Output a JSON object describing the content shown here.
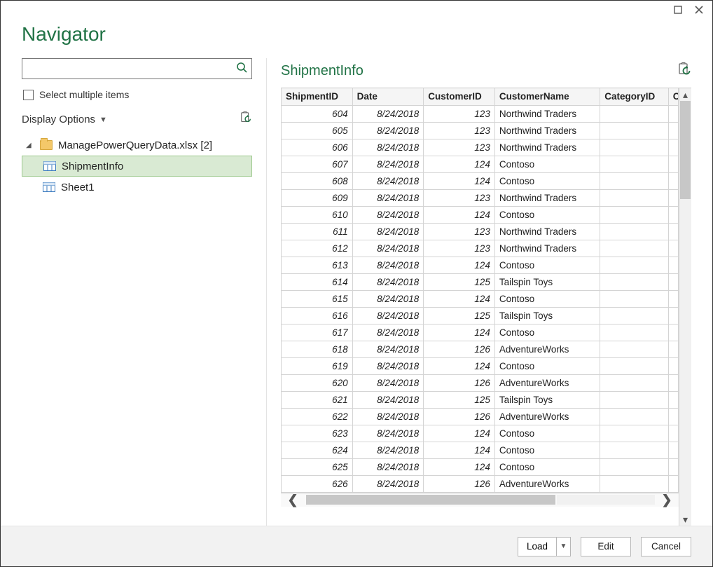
{
  "dialog_title": "Navigator",
  "left": {
    "search_placeholder": "",
    "select_multiple_label": "Select multiple items",
    "display_options_label": "Display Options",
    "tree": {
      "root_label": "ManagePowerQueryData.xlsx [2]",
      "items": [
        {
          "label": "ShipmentInfo",
          "selected": true
        },
        {
          "label": "Sheet1",
          "selected": false
        }
      ]
    }
  },
  "right": {
    "title": "ShipmentInfo",
    "columns": [
      "ShipmentID",
      "Date",
      "CustomerID",
      "CustomerName",
      "CategoryID",
      "C"
    ],
    "rows": [
      {
        "sid": "604",
        "date": "8/24/2018",
        "cid": "123",
        "cname": "Northwind Traders",
        "cat": ""
      },
      {
        "sid": "605",
        "date": "8/24/2018",
        "cid": "123",
        "cname": "Northwind Traders",
        "cat": ""
      },
      {
        "sid": "606",
        "date": "8/24/2018",
        "cid": "123",
        "cname": "Northwind Traders",
        "cat": ""
      },
      {
        "sid": "607",
        "date": "8/24/2018",
        "cid": "124",
        "cname": "Contoso",
        "cat": ""
      },
      {
        "sid": "608",
        "date": "8/24/2018",
        "cid": "124",
        "cname": "Contoso",
        "cat": ""
      },
      {
        "sid": "609",
        "date": "8/24/2018",
        "cid": "123",
        "cname": "Northwind Traders",
        "cat": ""
      },
      {
        "sid": "610",
        "date": "8/24/2018",
        "cid": "124",
        "cname": "Contoso",
        "cat": ""
      },
      {
        "sid": "611",
        "date": "8/24/2018",
        "cid": "123",
        "cname": "Northwind Traders",
        "cat": ""
      },
      {
        "sid": "612",
        "date": "8/24/2018",
        "cid": "123",
        "cname": "Northwind Traders",
        "cat": ""
      },
      {
        "sid": "613",
        "date": "8/24/2018",
        "cid": "124",
        "cname": "Contoso",
        "cat": ""
      },
      {
        "sid": "614",
        "date": "8/24/2018",
        "cid": "125",
        "cname": "Tailspin Toys",
        "cat": ""
      },
      {
        "sid": "615",
        "date": "8/24/2018",
        "cid": "124",
        "cname": "Contoso",
        "cat": ""
      },
      {
        "sid": "616",
        "date": "8/24/2018",
        "cid": "125",
        "cname": "Tailspin Toys",
        "cat": ""
      },
      {
        "sid": "617",
        "date": "8/24/2018",
        "cid": "124",
        "cname": "Contoso",
        "cat": ""
      },
      {
        "sid": "618",
        "date": "8/24/2018",
        "cid": "126",
        "cname": "AdventureWorks",
        "cat": ""
      },
      {
        "sid": "619",
        "date": "8/24/2018",
        "cid": "124",
        "cname": "Contoso",
        "cat": ""
      },
      {
        "sid": "620",
        "date": "8/24/2018",
        "cid": "126",
        "cname": "AdventureWorks",
        "cat": ""
      },
      {
        "sid": "621",
        "date": "8/24/2018",
        "cid": "125",
        "cname": "Tailspin Toys",
        "cat": ""
      },
      {
        "sid": "622",
        "date": "8/24/2018",
        "cid": "126",
        "cname": "AdventureWorks",
        "cat": ""
      },
      {
        "sid": "623",
        "date": "8/24/2018",
        "cid": "124",
        "cname": "Contoso",
        "cat": ""
      },
      {
        "sid": "624",
        "date": "8/24/2018",
        "cid": "124",
        "cname": "Contoso",
        "cat": ""
      },
      {
        "sid": "625",
        "date": "8/24/2018",
        "cid": "124",
        "cname": "Contoso",
        "cat": ""
      },
      {
        "sid": "626",
        "date": "8/24/2018",
        "cid": "126",
        "cname": "AdventureWorks",
        "cat": ""
      }
    ]
  },
  "footer": {
    "load_label": "Load",
    "edit_label": "Edit",
    "cancel_label": "Cancel"
  }
}
